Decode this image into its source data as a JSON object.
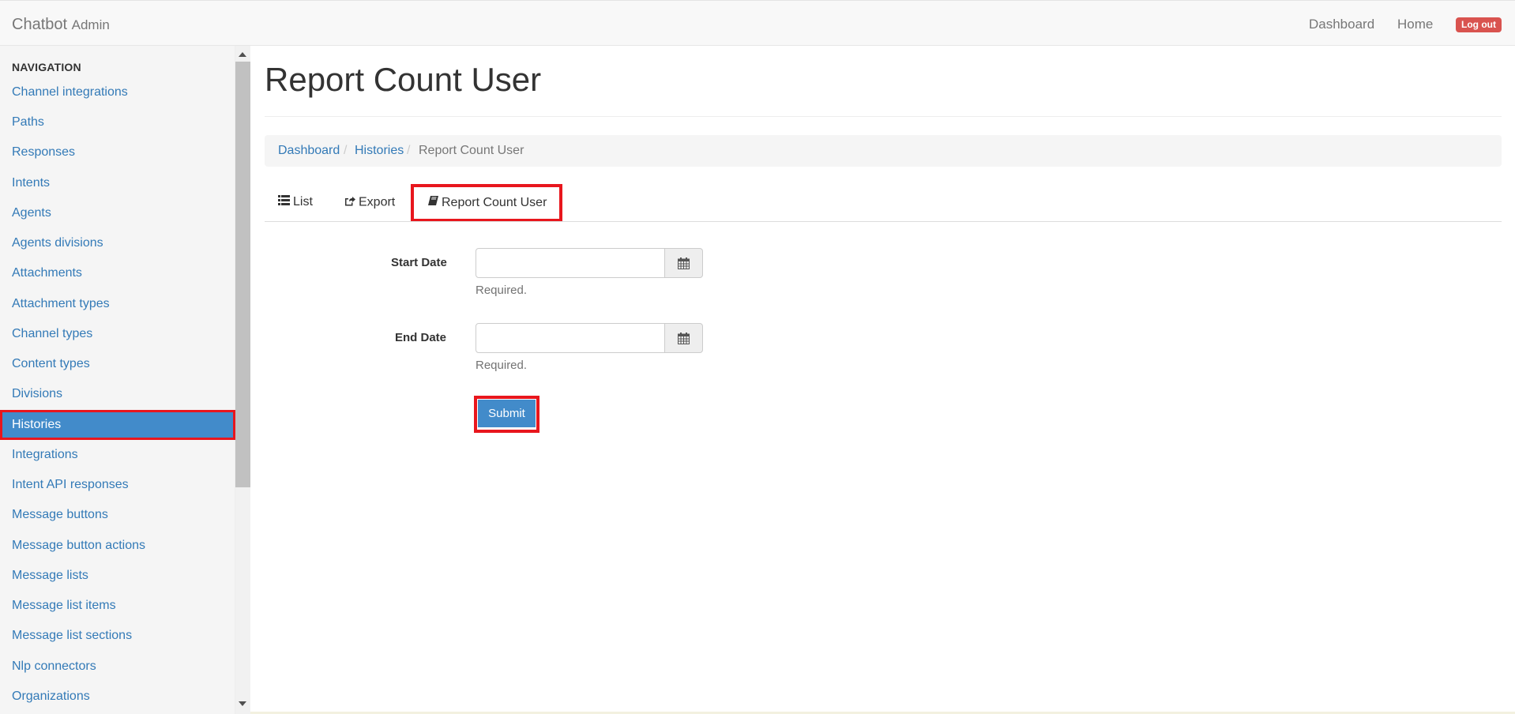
{
  "navbar": {
    "brand": "Chatbot",
    "brand_sub": "Admin",
    "links": [
      "Dashboard",
      "Home"
    ],
    "logout_label": "Log out"
  },
  "sidebar": {
    "header": "NAVIGATION",
    "items": [
      {
        "label": "Channel integrations"
      },
      {
        "label": "Paths"
      },
      {
        "label": "Responses"
      },
      {
        "label": "Intents"
      },
      {
        "label": "Agents"
      },
      {
        "label": "Agents divisions"
      },
      {
        "label": "Attachments"
      },
      {
        "label": "Attachment types"
      },
      {
        "label": "Channel types"
      },
      {
        "label": "Content types"
      },
      {
        "label": "Divisions"
      },
      {
        "label": "Histories",
        "active": true
      },
      {
        "label": "Integrations"
      },
      {
        "label": "Intent API responses"
      },
      {
        "label": "Message buttons"
      },
      {
        "label": "Message button actions"
      },
      {
        "label": "Message lists"
      },
      {
        "label": "Message list items"
      },
      {
        "label": "Message list sections"
      },
      {
        "label": "Nlp connectors"
      },
      {
        "label": "Organizations"
      }
    ]
  },
  "main": {
    "title": "Report Count User",
    "breadcrumb": [
      "Dashboard",
      "Histories",
      "Report Count User"
    ],
    "tabs": [
      {
        "label": "List",
        "icon": "list-icon"
      },
      {
        "label": "Export",
        "icon": "share-square-icon"
      },
      {
        "label": "Report Count User",
        "icon": "book-icon",
        "active": true
      }
    ],
    "form": {
      "start_label": "Start Date",
      "start_value": "",
      "start_help": "Required.",
      "end_label": "End Date",
      "end_value": "",
      "end_help": "Required.",
      "submit_label": "Submit"
    }
  },
  "colors": {
    "link": "#337ab7",
    "primary": "#428bca",
    "danger": "#d9534f",
    "highlight_outline": "#e8161d"
  }
}
